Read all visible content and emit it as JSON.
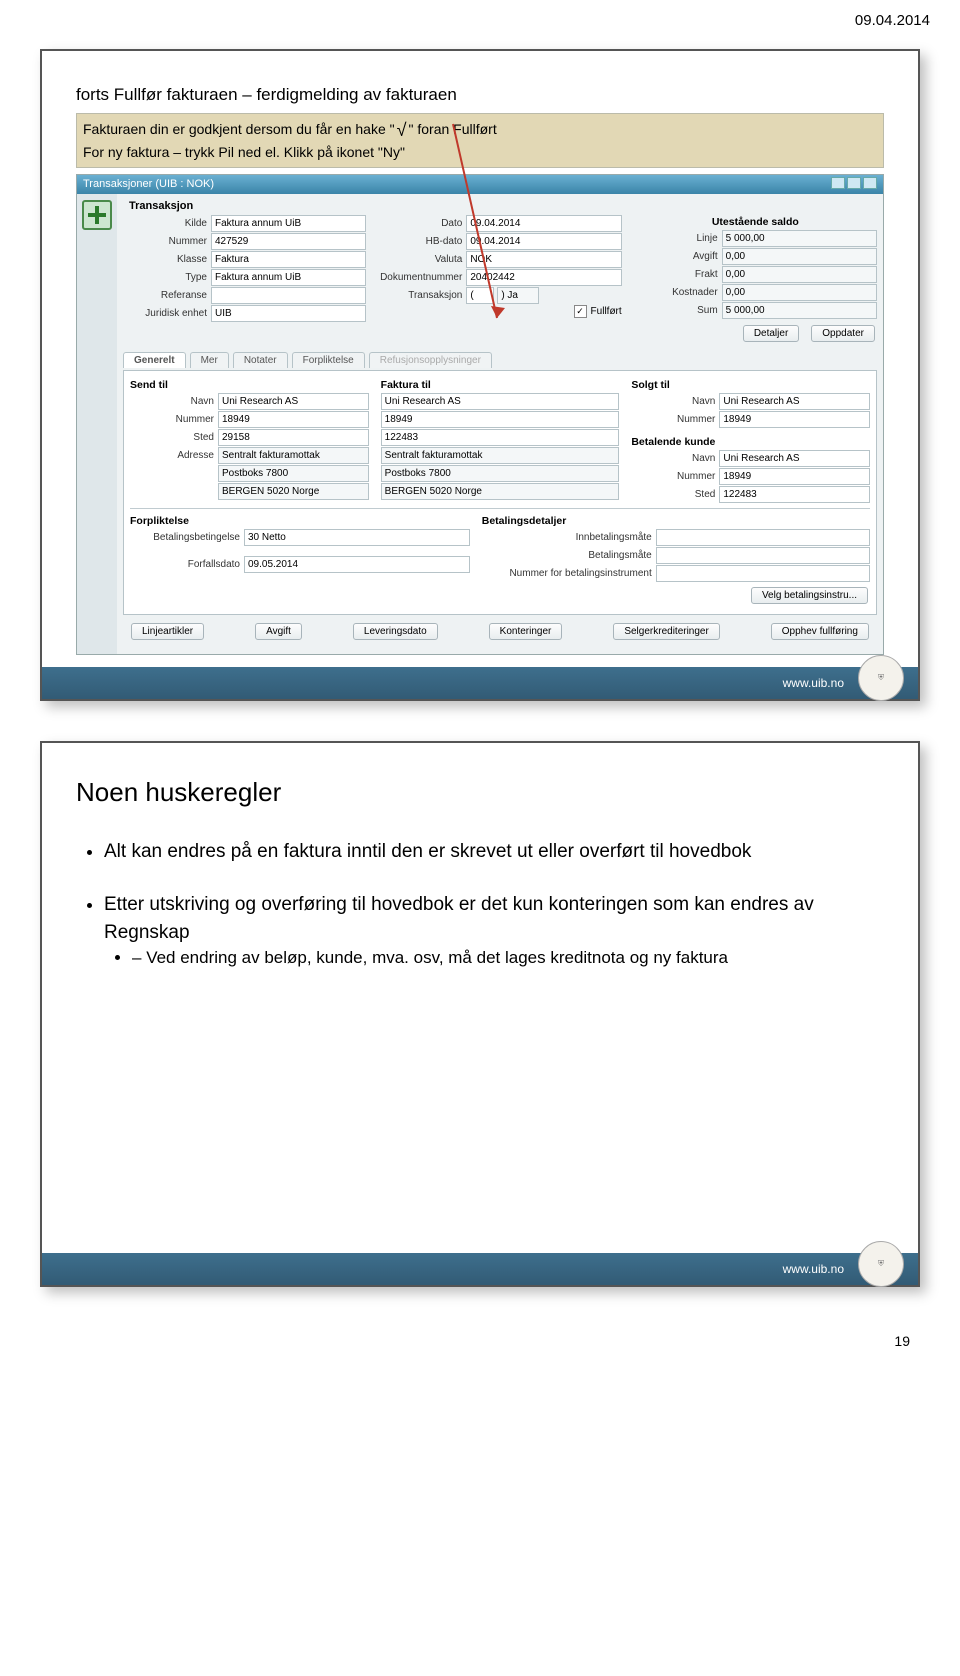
{
  "page_date": "09.04.2014",
  "page_number": "19",
  "footer_url": "www.uib.no",
  "slide1": {
    "title": "forts Fullfør fakturaen – ferdigmelding av fakturaen",
    "intro_line1a": "Fakturaen din er godkjent dersom du får en hake \"",
    "intro_line1b": "\" foran Fullført",
    "intro_line2": "For ny faktura – trykk Pil ned el. Klikk på ikonet \"Ny\"",
    "check_mark": "√",
    "app": {
      "titlebar": "Transaksjoner (UIB : NOK)",
      "section_trans": "Transaksjon",
      "left": {
        "Kilde": "Faktura annum UiB",
        "Nummer": "427529",
        "Klasse": "Faktura",
        "Type": "Faktura annum UiB",
        "Referanse": "",
        "Juridisk_enhet": "UIB"
      },
      "mid": {
        "Dato": "09.04.2014",
        "HB-dato": "09.04.2014",
        "Valuta": "NOK",
        "Dokumentnummer": "20402442",
        "Transaksjon_open": "(",
        "Transaksjon_ja": ") Ja"
      },
      "fullfort_label": "Fullført",
      "saldo_hdr": "Utestående saldo",
      "saldo": {
        "Linje": "5 000,00",
        "Avgift": "0,00",
        "Frakt": "0,00",
        "Kostnader": "0,00",
        "Sum": "5 000,00"
      },
      "btn_detaljer": "Detaljer",
      "btn_oppdater": "Oppdater",
      "tabs": [
        "Generelt",
        "Mer",
        "Notater",
        "Forpliktelse",
        "Refusjonsopplysninger"
      ],
      "sendtil_hdr": "Send til",
      "fakturatil_hdr": "Faktura til",
      "solgttil_hdr": "Solgt til",
      "betkunde_hdr": "Betalende kunde",
      "party": {
        "Navn": "Uni Research AS",
        "Nummer": "18949",
        "Sted": "29158",
        "Sted2": "122483",
        "Adresse1": "Sentralt fakturamottak",
        "Adresse2": "Postboks 7800",
        "Adresse3": "BERGEN 5020 Norge"
      },
      "forplikt_hdr": "Forpliktelse",
      "betbet_lbl": "Betalingsbetingelse",
      "betbet_val": "30 Netto",
      "forfall_lbl": "Forfallsdato",
      "forfall_val": "09.05.2014",
      "betdet_hdr": "Betalingsdetaljer",
      "betdet_rows": [
        "Innbetalingsmåte",
        "Betalingsmåte",
        "Nummer for betalingsinstrument"
      ],
      "btn_velg": "Velg betalingsinstru...",
      "bottom_buttons": [
        "Linjeartikler",
        "Avgift",
        "Leveringsdato",
        "Konteringer",
        "Selgerkrediteringer",
        "Opphev fullføring"
      ]
    }
  },
  "slide2": {
    "title": "Noen huskeregler",
    "b1": "Alt kan endres på en faktura inntil den er skrevet ut eller overført til hovedbok",
    "b2": "Etter utskriving og overføring til hovedbok er det kun konteringen som kan endres av Regnskap",
    "b2a": "Ved endring av beløp, kunde, mva. osv, må det lages kreditnota og ny faktura"
  }
}
